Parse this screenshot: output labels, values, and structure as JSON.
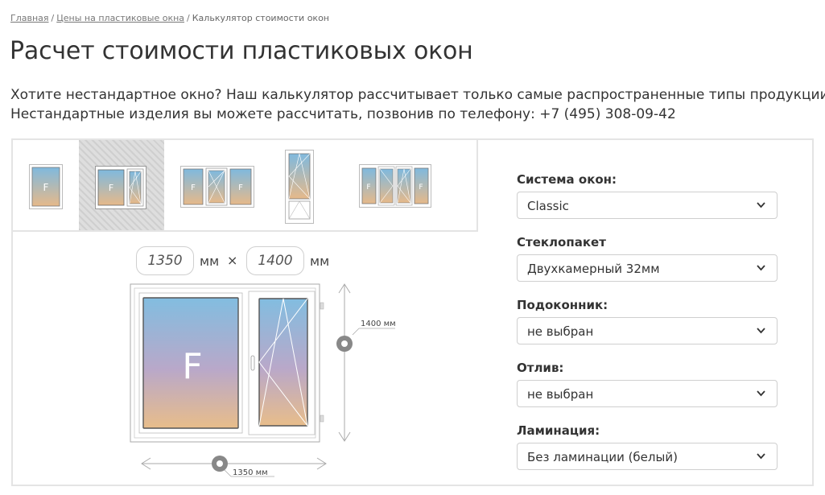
{
  "breadcrumb": {
    "home": "Главная",
    "prices": "Цены на пластиковые окна",
    "current": "Калькулятор стоимости окон",
    "sep": "/"
  },
  "page": {
    "title": "Расчет стоимости пластиковых окон",
    "intro_line1": "Хотите нестандартное окно? Наш калькулятор рассчитывает только самые распространенные типы продукции.",
    "intro_line2": "Нестандартные изделия вы можете рассчитать, позвонив по телефону: +7 (495) 308-09-42"
  },
  "window_types": [
    {
      "icon": "single-fixed-window-icon"
    },
    {
      "icon": "two-pane-window-icon",
      "selected": true
    },
    {
      "icon": "three-pane-window-icon"
    },
    {
      "icon": "balcony-door-icon"
    },
    {
      "icon": "four-pane-window-icon"
    }
  ],
  "dimensions": {
    "width_value": "1350",
    "height_value": "1400",
    "unit": "мм",
    "times": "×",
    "width_label": "1350 мм",
    "height_label": "1400 мм",
    "fixed_pane_letter": "F"
  },
  "options": {
    "system": {
      "label": "Система окон:",
      "value": "Classic"
    },
    "glass": {
      "label": "Стеклопакет",
      "value": "Двухкамерный 32мм"
    },
    "sill": {
      "label": "Подоконник:",
      "value": "не выбран"
    },
    "drain": {
      "label": "Отлив:",
      "value": "не выбран"
    },
    "lamination": {
      "label": "Ламинация:",
      "value": "Без ламинации (белый)"
    }
  },
  "colors": {
    "glass_top": "#7fb9de",
    "glass_bottom": "#e6b98a",
    "border": "#e4e4e4"
  }
}
